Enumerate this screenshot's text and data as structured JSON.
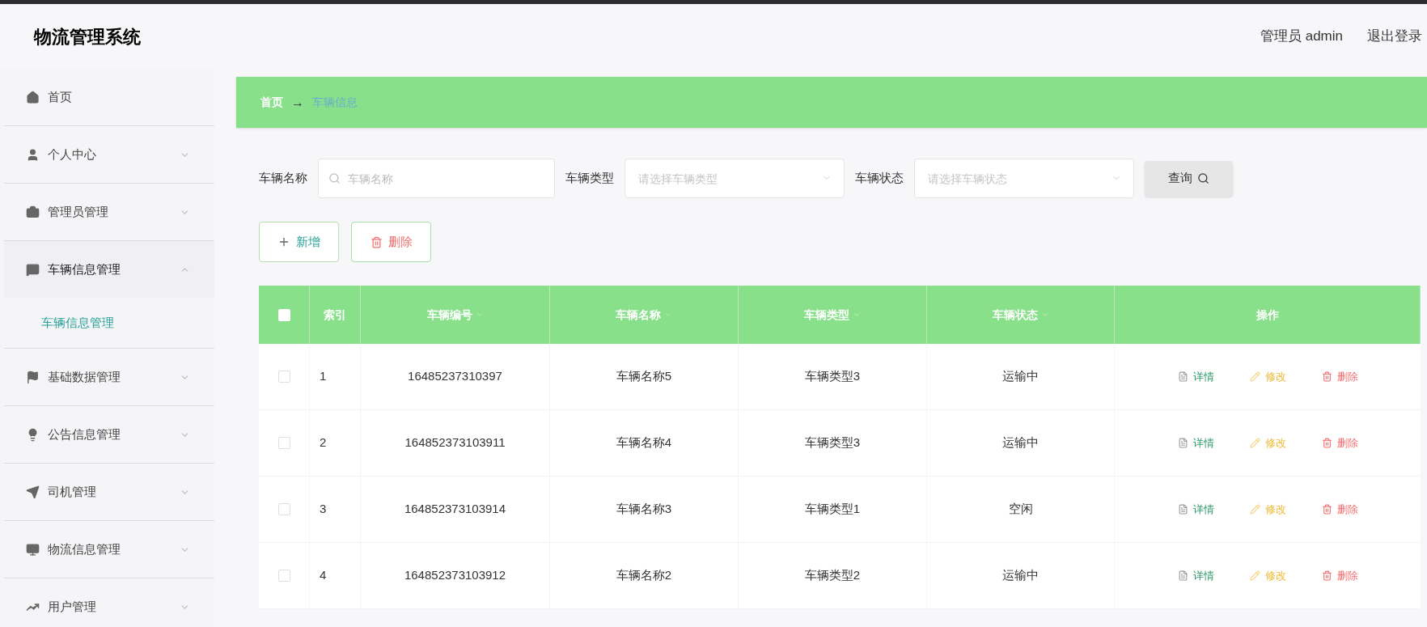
{
  "app_title": "物流管理系统",
  "header": {
    "user": "管理员 admin",
    "logout": "退出登录"
  },
  "sidebar": {
    "items": [
      {
        "label": "首页"
      },
      {
        "label": "个人中心",
        "expanded": false
      },
      {
        "label": "管理员管理",
        "expanded": false
      },
      {
        "label": "车辆信息管理",
        "expanded": true,
        "children": [
          {
            "label": "车辆信息管理",
            "selected": true
          }
        ]
      },
      {
        "label": "基础数据管理",
        "expanded": false
      },
      {
        "label": "公告信息管理",
        "expanded": false
      },
      {
        "label": "司机管理",
        "expanded": false
      },
      {
        "label": "物流信息管理",
        "expanded": false
      },
      {
        "label": "用户管理",
        "expanded": false
      }
    ]
  },
  "breadcrumb": {
    "home": "首页",
    "separator": "→",
    "current": "车辆信息"
  },
  "search": {
    "fields": [
      {
        "kind": "search",
        "label": "车辆名称",
        "placeholder": "车辆名称"
      },
      {
        "kind": "select",
        "label": "车辆类型",
        "placeholder": "请选择车辆类型"
      },
      {
        "kind": "select",
        "label": "车辆状态",
        "placeholder": "请选择车辆状态"
      }
    ],
    "button": "查询"
  },
  "toolbar": [
    {
      "kind": "add",
      "label": "新增"
    },
    {
      "kind": "delete",
      "label": "删除"
    }
  ],
  "table": {
    "all_checked": false,
    "columns": [
      {
        "label": "索引",
        "sortable": false
      },
      {
        "label": "车辆编号",
        "sortable": true
      },
      {
        "label": "车辆名称",
        "sortable": true
      },
      {
        "label": "车辆类型",
        "sortable": true
      },
      {
        "label": "车辆状态",
        "sortable": true
      },
      {
        "label": "操作",
        "sortable": false
      }
    ],
    "rows": [
      {
        "checked": false,
        "cells": [
          "1",
          "16485237310397",
          "车辆名称5",
          "车辆类型3",
          "运输中"
        ],
        "actions": [
          {
            "kind": "detail",
            "label": "详情"
          },
          {
            "kind": "edit",
            "label": "修改"
          },
          {
            "kind": "delete",
            "label": "删除"
          }
        ]
      },
      {
        "checked": false,
        "cells": [
          "2",
          "164852373103911",
          "车辆名称4",
          "车辆类型3",
          "运输中"
        ],
        "actions": [
          {
            "kind": "detail",
            "label": "详情"
          },
          {
            "kind": "edit",
            "label": "修改"
          },
          {
            "kind": "delete",
            "label": "删除"
          }
        ]
      },
      {
        "checked": false,
        "cells": [
          "3",
          "164852373103914",
          "车辆名称3",
          "车辆类型1",
          "空闲"
        ],
        "actions": [
          {
            "kind": "detail",
            "label": "详情"
          },
          {
            "kind": "edit",
            "label": "修改"
          },
          {
            "kind": "delete",
            "label": "删除"
          }
        ]
      },
      {
        "checked": false,
        "cells": [
          "4",
          "164852373103912",
          "车辆名称2",
          "车辆类型2",
          "运输中"
        ],
        "actions": [
          {
            "kind": "detail",
            "label": "详情"
          },
          {
            "kind": "edit",
            "label": "修改"
          },
          {
            "kind": "delete",
            "label": "删除"
          }
        ]
      }
    ]
  }
}
